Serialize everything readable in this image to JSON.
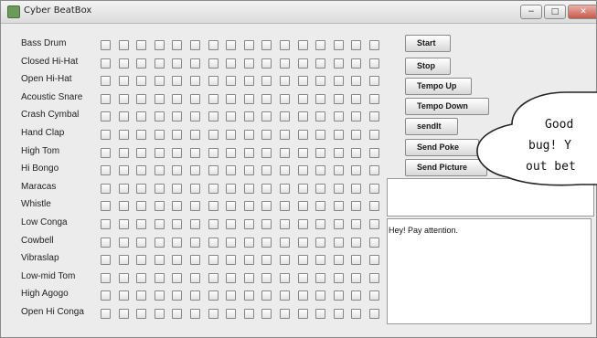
{
  "window": {
    "title": "Cyber BeatBox",
    "controls": {
      "minimize": "−",
      "maximize": "□",
      "close": "✕"
    }
  },
  "instruments": [
    "Bass Drum",
    "Closed Hi-Hat",
    "Open Hi-Hat",
    "Acoustic Snare",
    "Crash Cymbal",
    "Hand Clap",
    "High Tom",
    "Hi Bongo",
    "Maracas",
    "Whistle",
    "Low Conga",
    "Cowbell",
    "Vibraslap",
    "Low-mid Tom",
    "High Agogo",
    "Open Hi Conga"
  ],
  "beats_per_instrument": 16,
  "buttons": [
    "Start",
    "Stop",
    "Tempo Up",
    "Tempo Down",
    "sendIt",
    "Send Poke",
    "Send Picture"
  ],
  "message_area": {
    "text": "Hey! Pay attention."
  },
  "speech_bubble": {
    "lines": [
      "Good",
      "bug! Y",
      "out bet"
    ]
  }
}
